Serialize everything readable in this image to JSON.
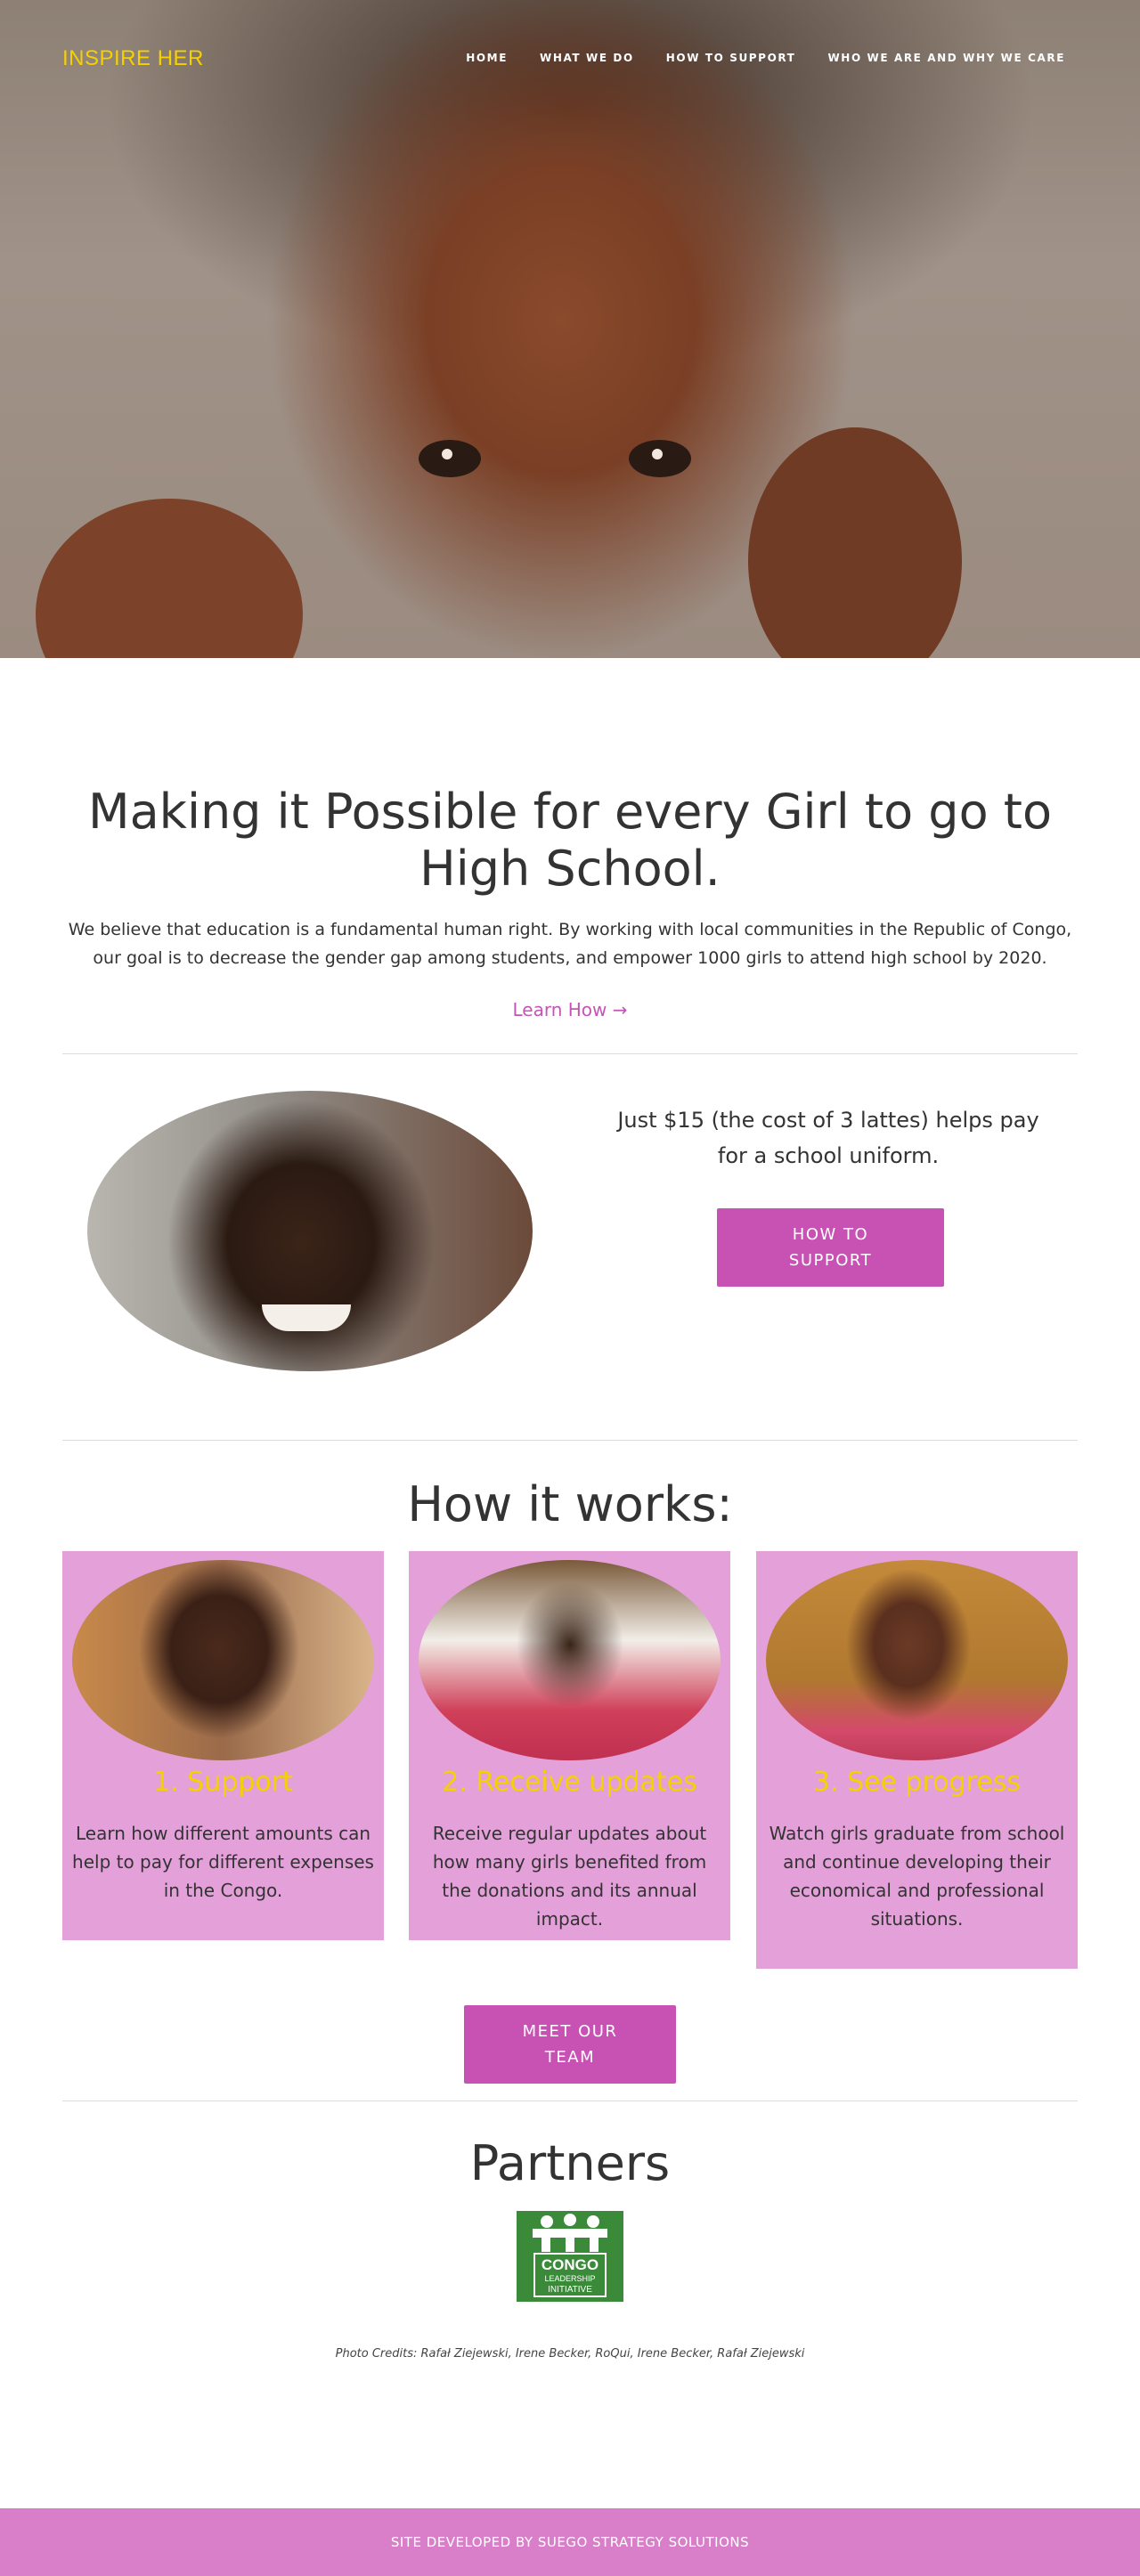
{
  "header": {
    "logo": "INSPIRE HER",
    "nav": [
      "HOME",
      "WHAT WE DO",
      "HOW TO SUPPORT",
      "WHO WE ARE AND WHY WE CARE"
    ]
  },
  "intro": {
    "title": "Making it Possible for every Girl to go to High School.",
    "text": "We believe that education is a fundamental human right. By working with local communities in the Republic of Congo, our goal is to decrease the gender gap among students, and empower 1000 girls to attend high school by 2020.",
    "link": "Learn How →"
  },
  "support": {
    "text": "Just $15 (the cost of 3 lattes) helps pay for a school uniform.",
    "button": "HOW TO SUPPORT"
  },
  "how_it_works": {
    "title": "How it works:",
    "cards": [
      {
        "title": "1. Support",
        "text": "Learn how different amounts can help to pay for different expenses in the Congo."
      },
      {
        "title": "2. Receive updates",
        "text": "Receive regular updates about how many girls benefited from the donations and its annual impact."
      },
      {
        "title": "3. See progress",
        "text": "Watch girls graduate from school and continue developing their economical and professional situations."
      }
    ],
    "button": "MEET OUR TEAM"
  },
  "partners": {
    "title": "Partners",
    "logo_text": [
      "CONGO",
      "LEADERSHIP",
      "INITIATIVE"
    ],
    "credits": "Photo Credits: Rafał Ziejewski, Irene Becker, RoQui, Irene Becker, Rafał Ziejewski"
  },
  "footer": {
    "text": "SITE DEVELOPED BY SUEGO STRATEGY SOLUTIONS"
  },
  "colors": {
    "accent": "#c852b4",
    "card": "#e3a0d9",
    "yellow": "#f5d100",
    "footer": "#d97ec9"
  }
}
